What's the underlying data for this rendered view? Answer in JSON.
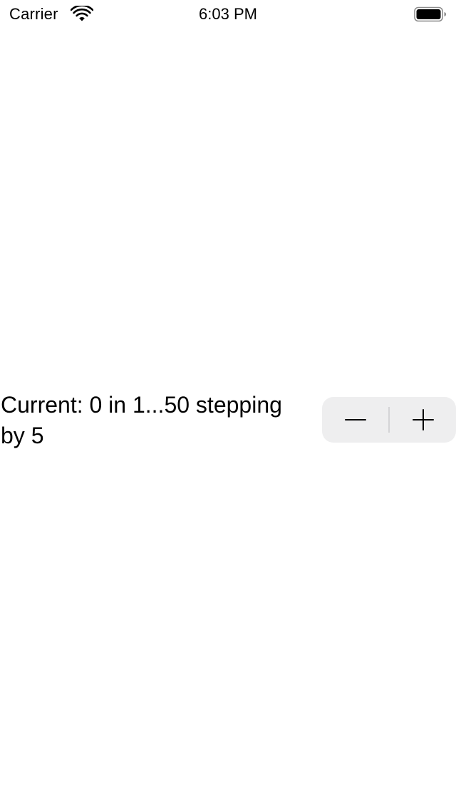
{
  "status_bar": {
    "carrier": "Carrier",
    "time": "6:03 PM",
    "icons": [
      "wifi-icon",
      "battery-icon"
    ]
  },
  "main": {
    "value_label": "Current: 0 in 1...50 stepping by 5",
    "stepper": {
      "decrement_icon": "minus-icon",
      "increment_icon": "plus-icon"
    }
  },
  "colors": {
    "background": "#ffffff",
    "text": "#000000",
    "stepper_background": "#eeeeef",
    "stepper_divider": "#d4d4d6"
  }
}
